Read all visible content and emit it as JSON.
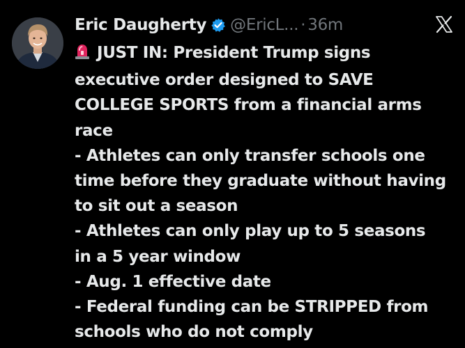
{
  "tweet": {
    "author_name": "Eric Daugherty",
    "handle": "@EricL...",
    "separator": "·",
    "timestamp": "36m",
    "verified_icon": "verified-badge-icon",
    "platform_icon": "x-logo-icon",
    "alert_icon": "siren-emoji-icon",
    "accent_color": "#1d9bf0",
    "lines": [
      "JUST IN: President Trump signs",
      "executive order designed to SAVE",
      "COLLEGE SPORTS from a financial arms",
      "race",
      "- Athletes can only transfer schools one",
      "time before they graduate without having",
      "to sit out a season",
      "- Athletes can only play up to 5 seasons",
      "in a 5 year window",
      "- Aug. 1 effective date",
      "- Federal funding can be STRIPPED from",
      "schools who do not comply"
    ]
  }
}
